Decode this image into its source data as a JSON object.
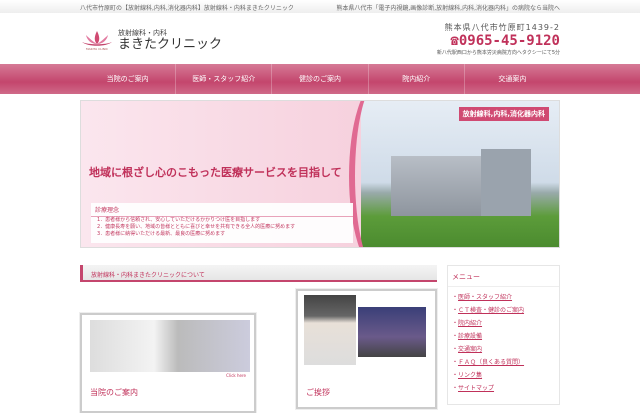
{
  "topbar": {
    "left": "八代市竹原町の【放射線科,内科,消化器内科】放射線科・内科まきたクリニック",
    "right": "熊本県八代市「電子内視鏡,画像診断,放射線科,内科,消化器内科」の病院なら当院へ"
  },
  "header": {
    "logo_sub": "放射線科・内科",
    "logo_main": "まきたクリニック",
    "logo_small": "MAKITA CLINIC",
    "address": "熊本県八代市竹原町1439-2",
    "tel": "0965-45-9120",
    "access": "新八代駅西口から熊本労災病院方向へタクシーにて5分"
  },
  "nav": [
    "当院のご案内",
    "医師・スタッフ紹介",
    "健診のご案内",
    "院内紹介",
    "交通案内"
  ],
  "hero": {
    "badge": "放射線科,内科,消化器内科",
    "title": "地域に根ざし心のこもった医療サービスを目指して",
    "philosophy_title": "診療理念",
    "philosophy": [
      "1．患者様から信頼され、安心していただけるかかりつけ医を目指します",
      "2．健康長寿を願い、地域の皆様とともに喜びと幸せを共有できる全人的医療に努めます",
      "3．患者様に納得いただける最新、最良の医療に努めます"
    ]
  },
  "section": {
    "title": "放射線科・内科まきたクリニックについて"
  },
  "cards": {
    "left_title": "当院のご案内",
    "click_here": "Click here",
    "right_title": "ご挨拶"
  },
  "sidebar": {
    "title": "メニュー",
    "items": [
      "医師・スタッフ紹介",
      "ＣＴ検査・健診のご案内",
      "院内紹介",
      "診療設備",
      "交通案内",
      "ＦＡＱ（良くある質問）",
      "リンク集",
      "サイトマップ"
    ]
  },
  "colors": {
    "accent": "#c4466d"
  }
}
